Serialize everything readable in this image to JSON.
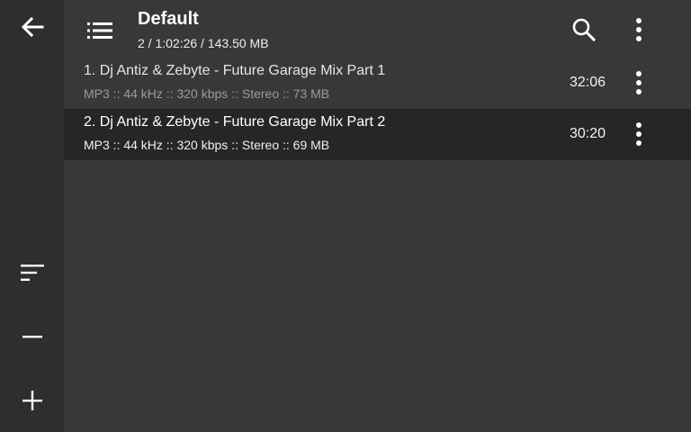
{
  "header": {
    "title": "Default",
    "subtitle": "2 / 1:02:26 / 143.50 MB"
  },
  "rail": {
    "icons": [
      "back-arrow-icon",
      "sort-icon",
      "minus-icon",
      "plus-icon"
    ]
  },
  "tracks": [
    {
      "title": "1. Dj Antiz & Zebyte - Future Garage Mix Part 1",
      "info": "MP3 :: 44 kHz :: 320 kbps :: Stereo :: 73 MB",
      "duration": "32:06",
      "selected": false
    },
    {
      "title": "2. Dj Antiz & Zebyte - Future Garage Mix Part 2",
      "info": "MP3 :: 44 kHz :: 320 kbps :: Stereo :: 69 MB",
      "duration": "30:20",
      "selected": true
    }
  ],
  "colors": {
    "background": "#383838",
    "rail": "#2e2e2e",
    "selected_row": "#262626",
    "dim_text": "#9a9a9a"
  }
}
